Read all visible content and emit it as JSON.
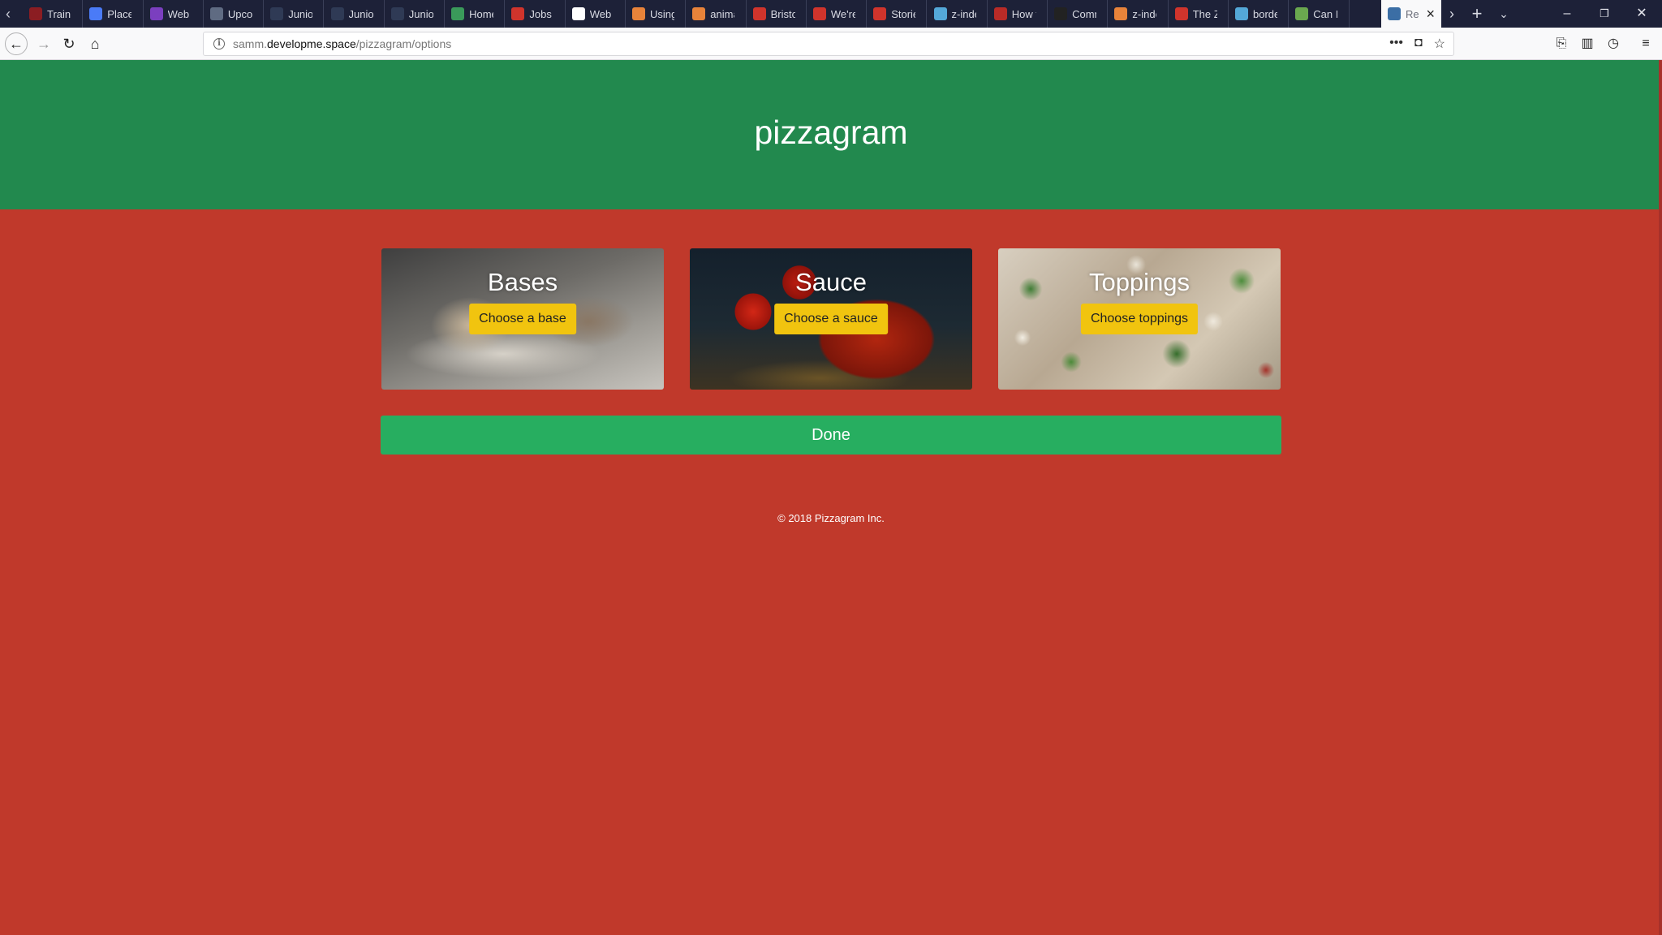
{
  "browser": {
    "tabs": [
      {
        "title": "Train",
        "color": "#8b1d22"
      },
      {
        "title": "Places",
        "color": "#4a7bf7"
      },
      {
        "title": "Web D",
        "color": "#7b3fbf"
      },
      {
        "title": "Upcon",
        "color": "#5f6b82"
      },
      {
        "title": "Junior",
        "color": "#2f3a55"
      },
      {
        "title": "Junior",
        "color": "#2f3a55"
      },
      {
        "title": "Junior",
        "color": "#2f3a55"
      },
      {
        "title": "Home",
        "color": "#3a9a5a"
      },
      {
        "title": "Jobs a",
        "color": "#d0342c"
      },
      {
        "title": "Web d",
        "color": "#ffffff"
      },
      {
        "title": "Using",
        "color": "#e8833a"
      },
      {
        "title": "anima",
        "color": "#e8833a"
      },
      {
        "title": "Bristol",
        "color": "#d0342c"
      },
      {
        "title": "We're",
        "color": "#d0342c"
      },
      {
        "title": "Storie",
        "color": "#d0342c"
      },
      {
        "title": "z-inde",
        "color": "#54a8d8"
      },
      {
        "title": "How t",
        "color": "#b92b27"
      },
      {
        "title": "Comm",
        "color": "#222222"
      },
      {
        "title": "z-inde",
        "color": "#e8833a"
      },
      {
        "title": "The Z",
        "color": "#d0342c"
      },
      {
        "title": "borde",
        "color": "#54a8d8"
      },
      {
        "title": "Can I",
        "color": "#6aa84f"
      }
    ],
    "active_tab": {
      "title": "Re",
      "color": "#3b6ea5"
    },
    "url_prefix": "samm.",
    "url_domain": "developme.space",
    "url_path": "/pizzagram/options"
  },
  "page": {
    "title": "pizzagram",
    "cards": [
      {
        "title": "Bases",
        "button": "Choose a base"
      },
      {
        "title": "Sauce",
        "button": "Choose a sauce"
      },
      {
        "title": "Toppings",
        "button": "Choose toppings"
      }
    ],
    "done_label": "Done",
    "footer": "© 2018 Pizzagram Inc."
  },
  "colors": {
    "header_green": "#22894e",
    "page_red": "#c0392b",
    "button_yellow": "#f1c40f",
    "done_green": "#27ae60"
  }
}
